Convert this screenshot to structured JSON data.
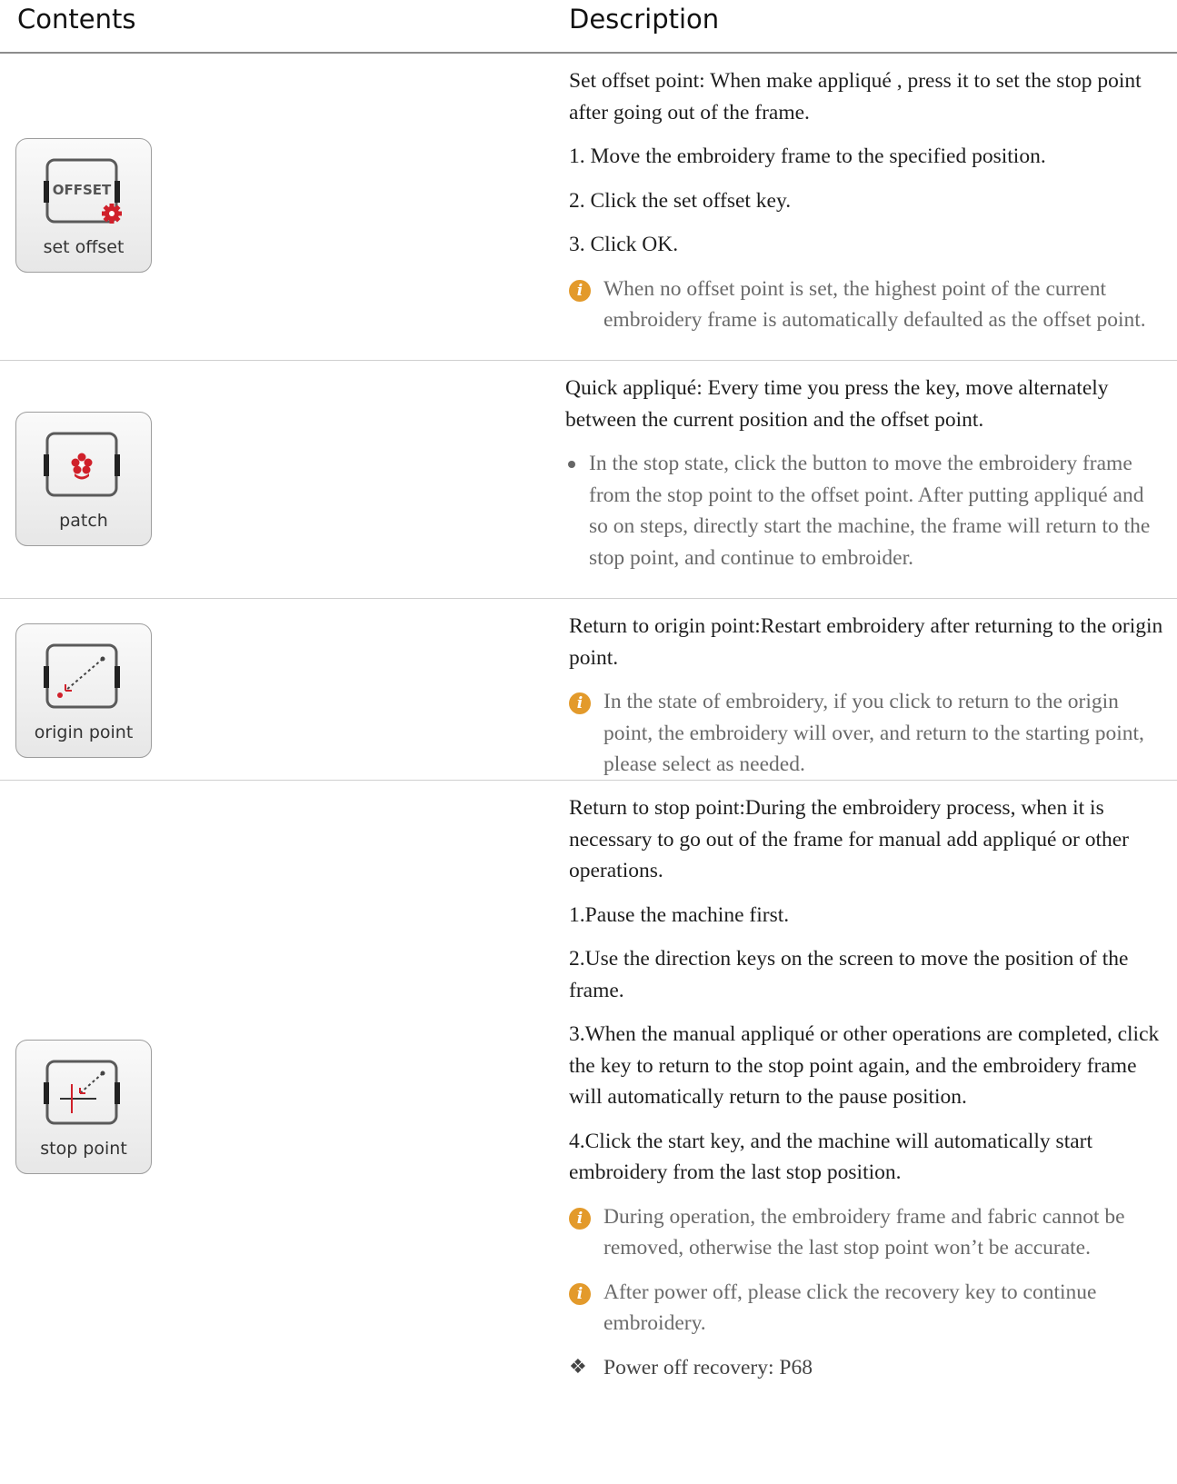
{
  "header": {
    "contents": "Contents",
    "description": "Description"
  },
  "rows": [
    {
      "icon": {
        "name": "set-offset-icon",
        "label": "set offset",
        "inner_text": "OFFSET"
      },
      "paragraphs": [
        "Set offset point: When make appliqué , press it to set the stop point after going out of the frame.",
        "1. Move the embroidery frame to the specified position.",
        "2. Click the set offset key.",
        "3. Click OK."
      ],
      "notes": [
        "When no offset point is set, the highest point of the current embroidery frame is automatically defaulted as the offset point."
      ]
    },
    {
      "icon": {
        "name": "patch-icon",
        "label": "patch"
      },
      "paragraphs": [
        "Quick appliqué: Every time you press the key, move alternately between the current position and the offset point."
      ],
      "bullets": [
        "In the stop state, click the button to move the embroidery frame from the stop point to the offset point. After putting appliqué and so on steps, directly start the machine, the frame will return to the stop point, and continue to embroider."
      ]
    },
    {
      "icon": {
        "name": "origin-point-icon",
        "label": "origin point"
      },
      "paragraphs": [
        "Return to origin point:Restart embroidery after returning to the origin point."
      ],
      "notes": [
        "In the state of embroidery, if you click to return to the origin point, the embroidery will over, and return to the starting point, please select as needed."
      ]
    },
    {
      "icon": {
        "name": "stop-point-icon",
        "label": "stop point"
      },
      "paragraphs": [
        "Return to stop point:During the embroidery process, when it is necessary to go out of the frame for manual add appliqué or other operations.",
        "1.Pause the machine first.",
        "2.Use the direction keys on the screen to move the position of the frame.",
        "3.When the manual appliqué or other operations are completed, click the key to return to the stop point again, and the embroidery frame will automatically return to the pause position.",
        "4.Click the start key, and the machine will automatically start embroidery from the last stop position."
      ],
      "notes": [
        "During operation, the embroidery frame and fabric cannot be removed, otherwise the last stop point won’t be accurate.",
        "After power off, please click the  recovery key to continue embroidery."
      ],
      "reference": "Power off  recovery:  P68"
    }
  ],
  "info_symbol": "i",
  "ref_symbol": "❖",
  "colors": {
    "accent_red": "#d0202a",
    "info_orange": "#e39a2b",
    "frame": "#5a5a5a"
  }
}
